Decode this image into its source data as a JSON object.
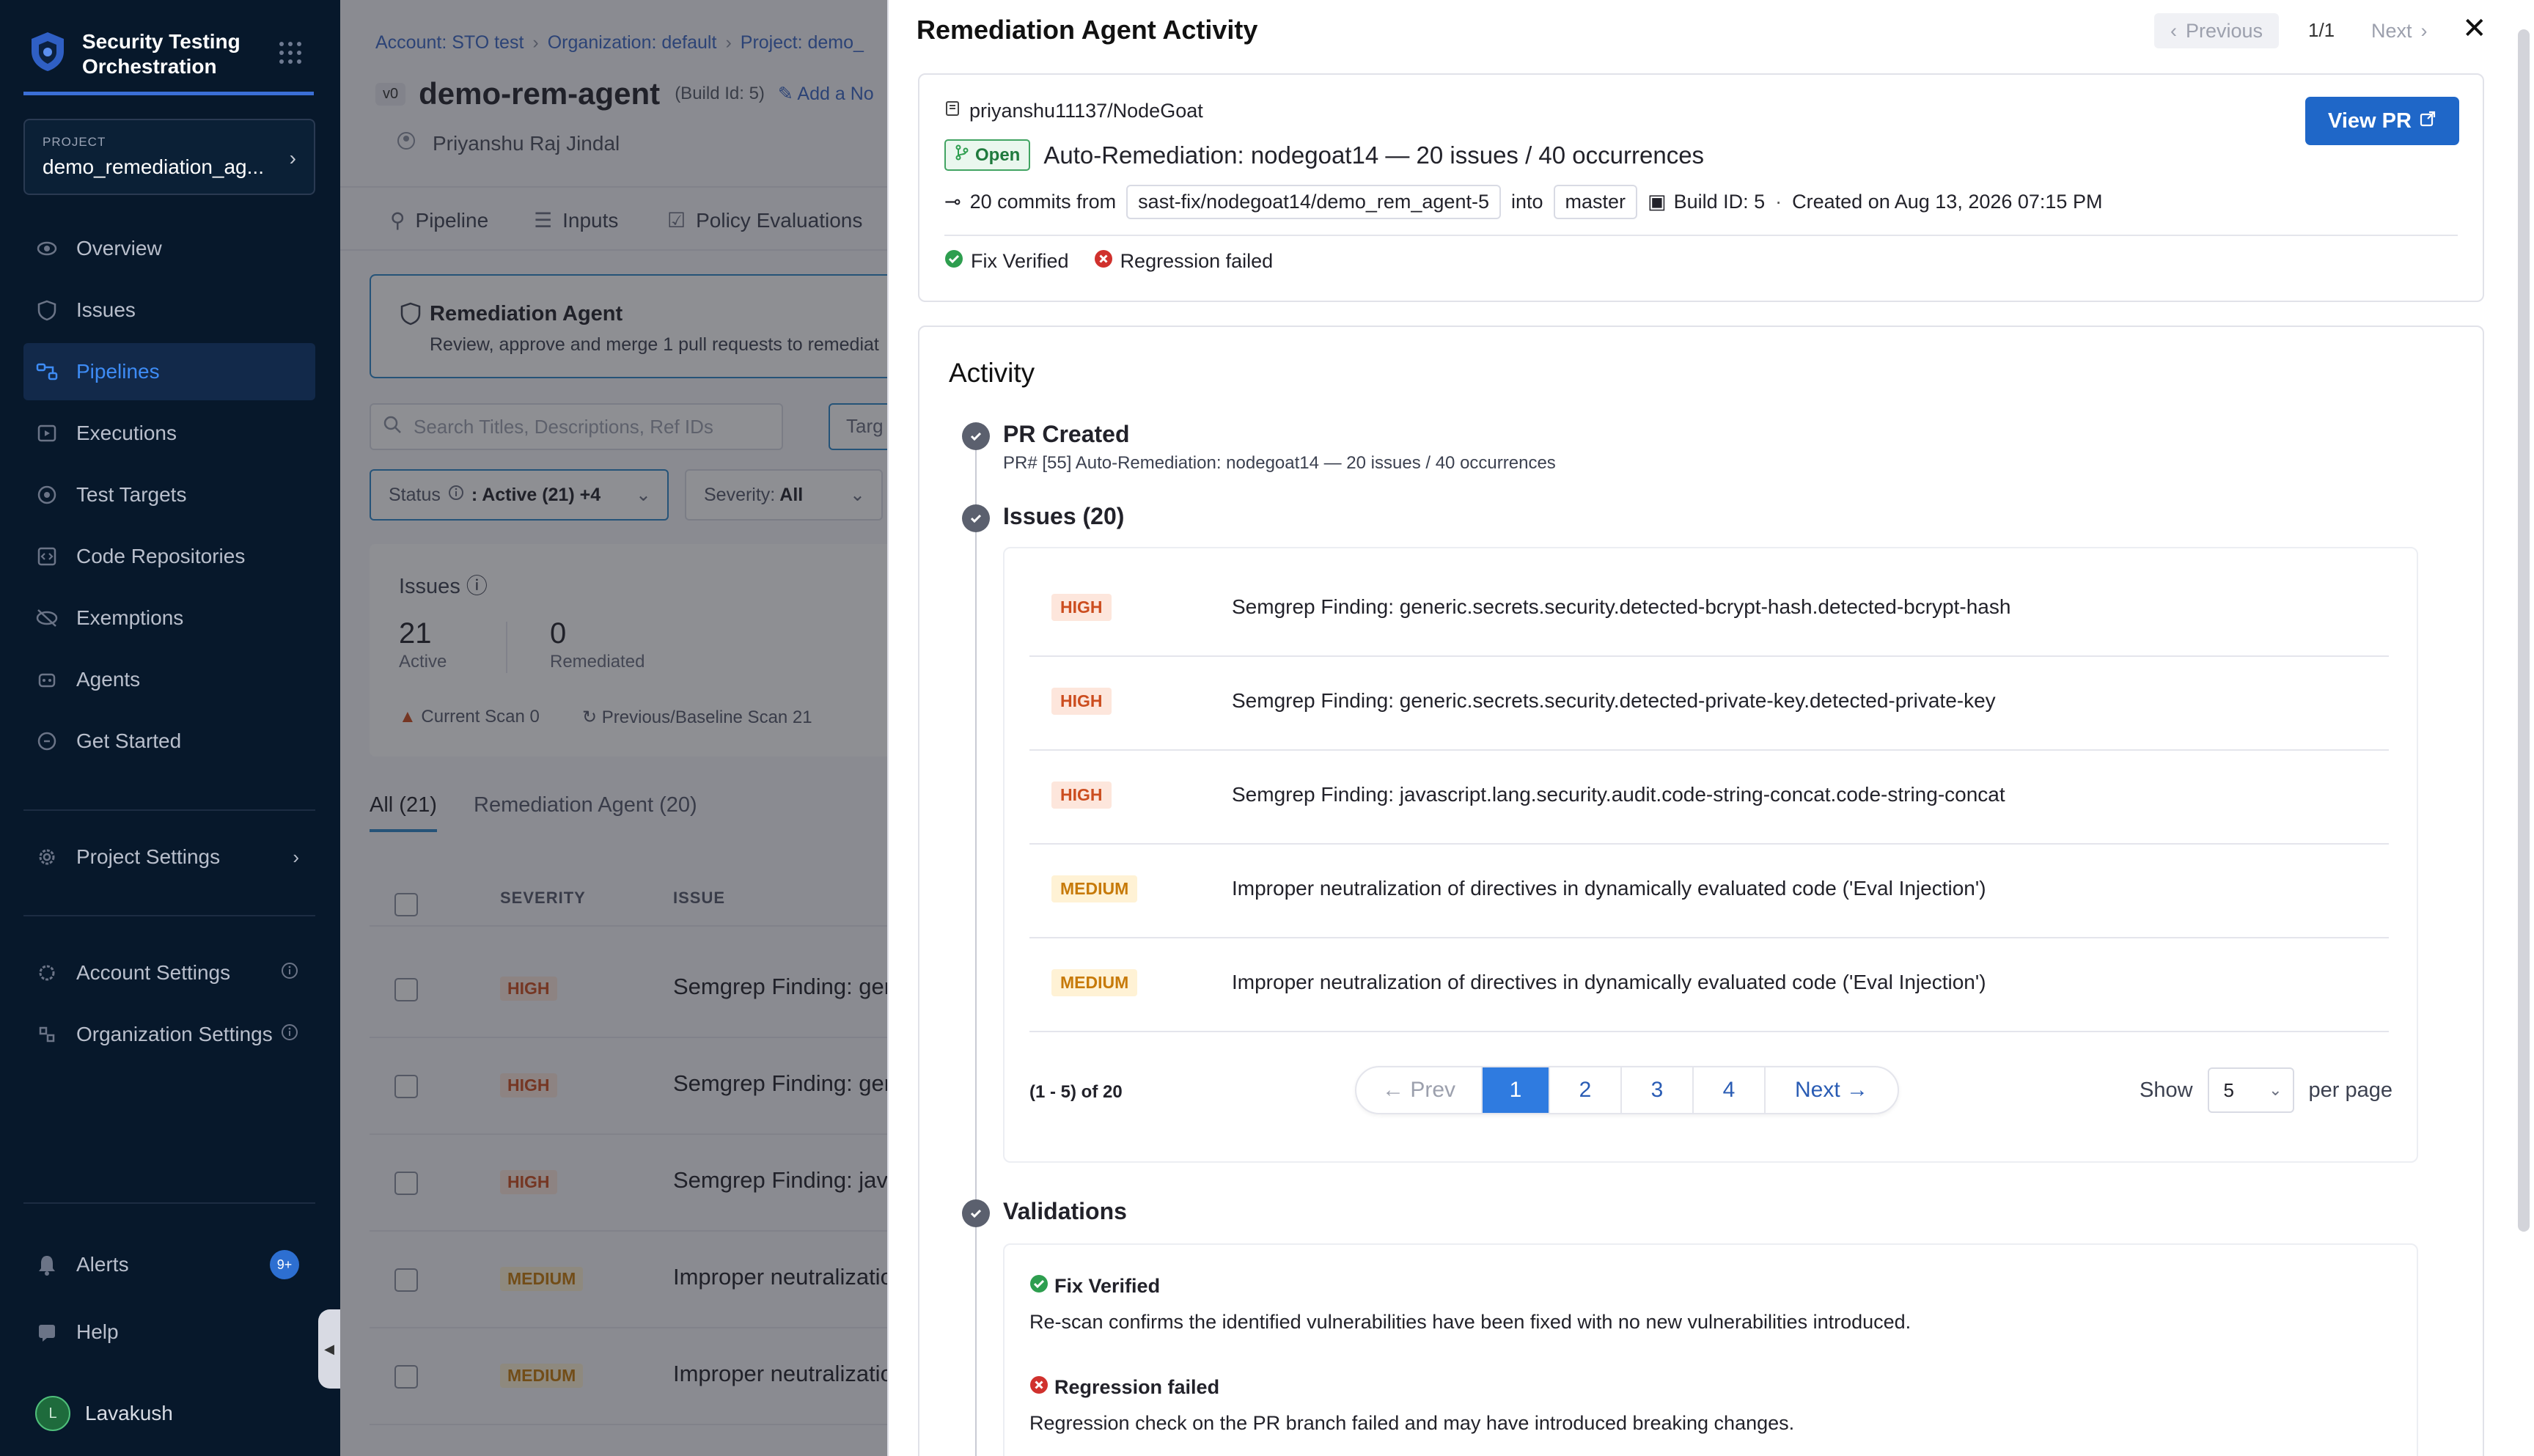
{
  "nav": {
    "brand_line1": "Security Testing",
    "brand_line2": "Orchestration",
    "project_caption": "PROJECT",
    "project_value": "demo_remediation_ag...",
    "items": [
      {
        "label": "Overview",
        "icon": "eye-icon"
      },
      {
        "label": "Issues",
        "icon": "shield-icon"
      },
      {
        "label": "Pipelines",
        "icon": "pipeline-icon"
      },
      {
        "label": "Executions",
        "icon": "executions-icon"
      },
      {
        "label": "Test Targets",
        "icon": "target-icon"
      },
      {
        "label": "Code Repositories",
        "icon": "code-icon"
      },
      {
        "label": "Exemptions",
        "icon": "eye-off-icon"
      },
      {
        "label": "Agents",
        "icon": "agent-icon"
      },
      {
        "label": "Get Started",
        "icon": "rocket-icon"
      }
    ],
    "active_item": "Pipelines",
    "project_settings": "Project Settings",
    "account_settings": "Account Settings",
    "org_settings": "Organization Settings",
    "alerts": "Alerts",
    "alerts_badge": "9+",
    "help": "Help",
    "user_initial": "L",
    "user_name": "Lavakush"
  },
  "page": {
    "breadcrumb": [
      "Account: STO test",
      "Organization: default",
      "Project: demo_"
    ],
    "version_badge": "v0",
    "title": "demo-rem-agent",
    "build_id": "(Build Id: 5)",
    "add_note": "Add a No",
    "author": "Priyanshu Raj Jindal",
    "tabs": [
      "Pipeline",
      "Inputs",
      "Policy Evaluations"
    ],
    "remediation_title": "Remediation Agent",
    "remediation_sub": "Review, approve and merge 1 pull requests to remediat",
    "search_placeholder": "Search Titles, Descriptions, Ref IDs",
    "target_btn": "Targ",
    "filter_status_label": "Status",
    "filter_status_value": ": Active (21) +4",
    "filter_severity_label": "Severity:",
    "filter_severity_value": "All",
    "issues_label": "Issues",
    "active_count": "21",
    "active_label": "Active",
    "remediated_count": "0",
    "remediated_label": "Remediated",
    "current_scan": "Current Scan 0",
    "baseline_scan": "Previous/Baseline Scan 21",
    "subtabs": [
      "All (21)",
      "Remediation Agent (20)"
    ],
    "col_severity": "SEVERITY",
    "col_issue": "ISSUE",
    "rows": [
      {
        "severity": "HIGH",
        "issue": "Semgrep Finding: generic"
      },
      {
        "severity": "HIGH",
        "issue": "Semgrep Finding: generic"
      },
      {
        "severity": "HIGH",
        "issue": "Semgrep Finding: javascr"
      },
      {
        "severity": "MEDIUM",
        "issue": "Improper neutralization o"
      },
      {
        "severity": "MEDIUM",
        "issue": "Improper neutralization o"
      }
    ]
  },
  "drawer": {
    "title": "Remediation Agent Activity",
    "prev_label": "Previous",
    "count": "1/1",
    "next_label": "Next",
    "repo": "priyanshu11137/NodeGoat",
    "open_badge": "Open",
    "pr_title": "Auto-Remediation: nodegoat14 — 20 issues / 40 occurrences",
    "commits_text": "20 commits from",
    "source_branch": "sast-fix/nodegoat14/demo_rem_agent-5",
    "into_text": "into",
    "target_branch": "master",
    "build_id": "Build ID: 5",
    "created": "Created on Aug 13, 2026 07:15 PM",
    "fix_verified": "Fix Verified",
    "regression_failed": "Regression failed",
    "view_pr": "View PR",
    "activity": {
      "heading": "Activity",
      "pr_created": "PR Created",
      "pr_created_sub": "PR# [55] Auto-Remediation: nodegoat14 — 20 issues / 40 occurrences",
      "issues_heading": "Issues (20)",
      "issues": [
        {
          "severity": "HIGH",
          "text": "Semgrep Finding: generic.secrets.security.detected-bcrypt-hash.detected-bcrypt-hash"
        },
        {
          "severity": "HIGH",
          "text": "Semgrep Finding: generic.secrets.security.detected-private-key.detected-private-key"
        },
        {
          "severity": "HIGH",
          "text": "Semgrep Finding: javascript.lang.security.audit.code-string-concat.code-string-concat"
        },
        {
          "severity": "MEDIUM",
          "text": "Improper neutralization of directives in dynamically evaluated code ('Eval Injection')"
        },
        {
          "severity": "MEDIUM",
          "text": "Improper neutralization of directives in dynamically evaluated code ('Eval Injection')"
        }
      ],
      "range": "(1 - 5) of 20",
      "pager_prev": "← Prev",
      "pages": [
        "1",
        "2",
        "3",
        "4"
      ],
      "current_page": "1",
      "pager_next": "Next →",
      "show_label": "Show",
      "per_page_value": "5",
      "per_page_label": "per page",
      "validations_heading": "Validations",
      "fix_verified_title": "Fix Verified",
      "fix_verified_desc": "Re-scan confirms the identified vulnerabilities have been fixed with no new vulnerabilities introduced.",
      "regression_title": "Regression failed",
      "regression_desc": "Regression check on the PR branch failed and may have introduced breaking changes."
    }
  },
  "colors": {
    "nav_bg": "#07182b",
    "accent": "#2f7be0",
    "high": "#cc4d1f",
    "medium": "#c77a09",
    "success": "#2e9e4f",
    "error": "#d0312d"
  }
}
